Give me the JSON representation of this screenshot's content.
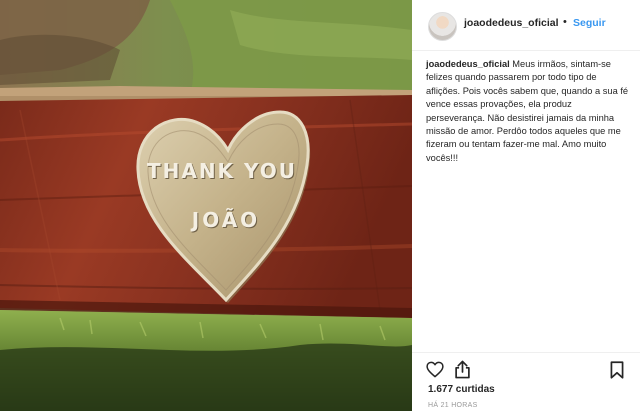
{
  "post": {
    "username": "joaodedeus_oficial",
    "separator": "•",
    "follow_label": "Seguir",
    "caption_username": "joaodedeus_oficial",
    "caption_text": "Meus irmãos, sintam-se felizes quando passarem por todo tipo de aflições. Pois vocês sabem que, quando a sua fé vence essas provações, ela produz perseverança. Não desistirei jamais da minha missão de amor. Perdôo todos aqueles que me fizeram ou tentam fazer-me mal. Amo muito vocês!!!",
    "likes": "1.677 curtidas",
    "timestamp": "HÁ 21 HORAS"
  },
  "photo": {
    "plaque_line1": "THANK YOU",
    "plaque_line2": "JOÃO"
  },
  "icons": {
    "like": "heart-outline-icon",
    "share": "share-upload-icon",
    "save": "bookmark-icon"
  },
  "colors": {
    "follow": "#3897f0",
    "bench_wood": "#8e2d1c",
    "plaque": "#c9b893"
  }
}
